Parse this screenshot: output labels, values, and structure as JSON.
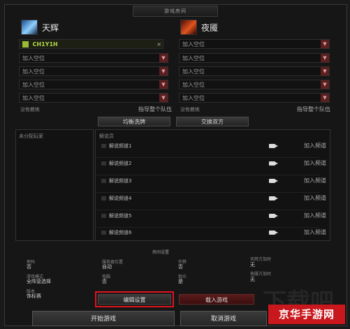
{
  "header": {
    "title": "游戏房间"
  },
  "radiant": {
    "name": "天辉",
    "player": "CH1Y1H",
    "close": "×",
    "slots": [
      "加入空位",
      "加入空位",
      "加入空位",
      "加入空位"
    ],
    "no_coach": "没有教练",
    "lead_team": "指导整个队伍"
  },
  "dire": {
    "name": "夜魇",
    "slots": [
      "加入空位",
      "加入空位",
      "加入空位",
      "加入空位",
      "加入空位"
    ],
    "no_coach": "没有教练",
    "lead_team": "指导整个队伍"
  },
  "actions": {
    "shuffle": "均衡洗牌",
    "swap": "交换双方"
  },
  "unassigned": {
    "title": "未分配玩家"
  },
  "broadcast": {
    "title": "解说员",
    "join_label": "加入频道",
    "channels": [
      "解说频道1",
      "解说频道2",
      "解说频道3",
      "解说频道4",
      "解说频道5",
      "解说频道6"
    ]
  },
  "settings": {
    "title": "房间设置",
    "password_label": "密码",
    "password_value": "否",
    "server_label": "服务器位置",
    "server_value": "自动",
    "cheats_label": "作弊",
    "cheats_value": "否",
    "radiant_bonus_label": "天辉方加时",
    "radiant_bonus_value": "无",
    "mode_label": "游戏模式",
    "mode_value": "全阵营选择",
    "bots_label": "电脑",
    "bots_value": "否",
    "spectators_label": "观众",
    "spectators_value": "是",
    "dire_bonus_label": "夜魇方加时",
    "dire_bonus_value": "无",
    "version_label": "版本",
    "version_value": "饰标赛"
  },
  "buttons": {
    "edit": "编辑设置",
    "load": "载入游戏",
    "start": "开始游戏",
    "cancel": "取消游戏"
  },
  "watermark": "下载吧",
  "brand": "京华手游网",
  "colors": {
    "accent_red": "#e0141e",
    "player_green": "#b5d84a",
    "dropdown_red": "#5b1f1f"
  }
}
